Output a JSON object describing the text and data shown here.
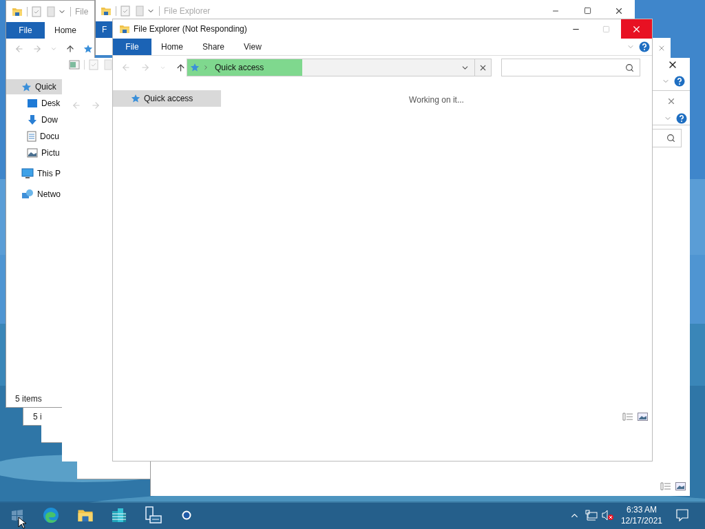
{
  "left_window": {
    "title": "File",
    "tabs": [
      {
        "label": "File",
        "selected": true
      },
      {
        "label": "Home",
        "selected": false
      }
    ],
    "nav_items": [
      {
        "label": "Quick",
        "kind": "pin",
        "selected": true,
        "children": [
          {
            "label": "Desk",
            "kind": "desktop",
            "selected": false
          },
          {
            "label": "Dow",
            "kind": "download",
            "selected": false
          },
          {
            "label": "Docu",
            "kind": "document",
            "selected": false
          },
          {
            "label": "Pictu",
            "kind": "pictures",
            "selected": false
          }
        ]
      },
      {
        "label": "This P",
        "kind": "computer",
        "selected": false
      },
      {
        "label": "Netwo",
        "kind": "network",
        "selected": false
      }
    ],
    "status_bar": "5 items"
  },
  "ghost_status": "5 i",
  "middle_window": {
    "title": "File Explorer",
    "tabs": [
      {
        "label": "F",
        "selected": true
      }
    ]
  },
  "main_window": {
    "title": "File Explorer (Not Responding)",
    "tabs": [
      {
        "label": "File",
        "selected": true
      },
      {
        "label": "Home",
        "selected": false
      },
      {
        "label": "Share",
        "selected": false
      },
      {
        "label": "View",
        "selected": false
      }
    ],
    "address": {
      "path": "Quick access",
      "level": 0.4
    },
    "nav_items": [
      {
        "label": "Quick access",
        "selected": true
      }
    ],
    "message": "Working on it..."
  },
  "clock": {
    "time": "6:33 AM",
    "date": "12/17/2021"
  }
}
